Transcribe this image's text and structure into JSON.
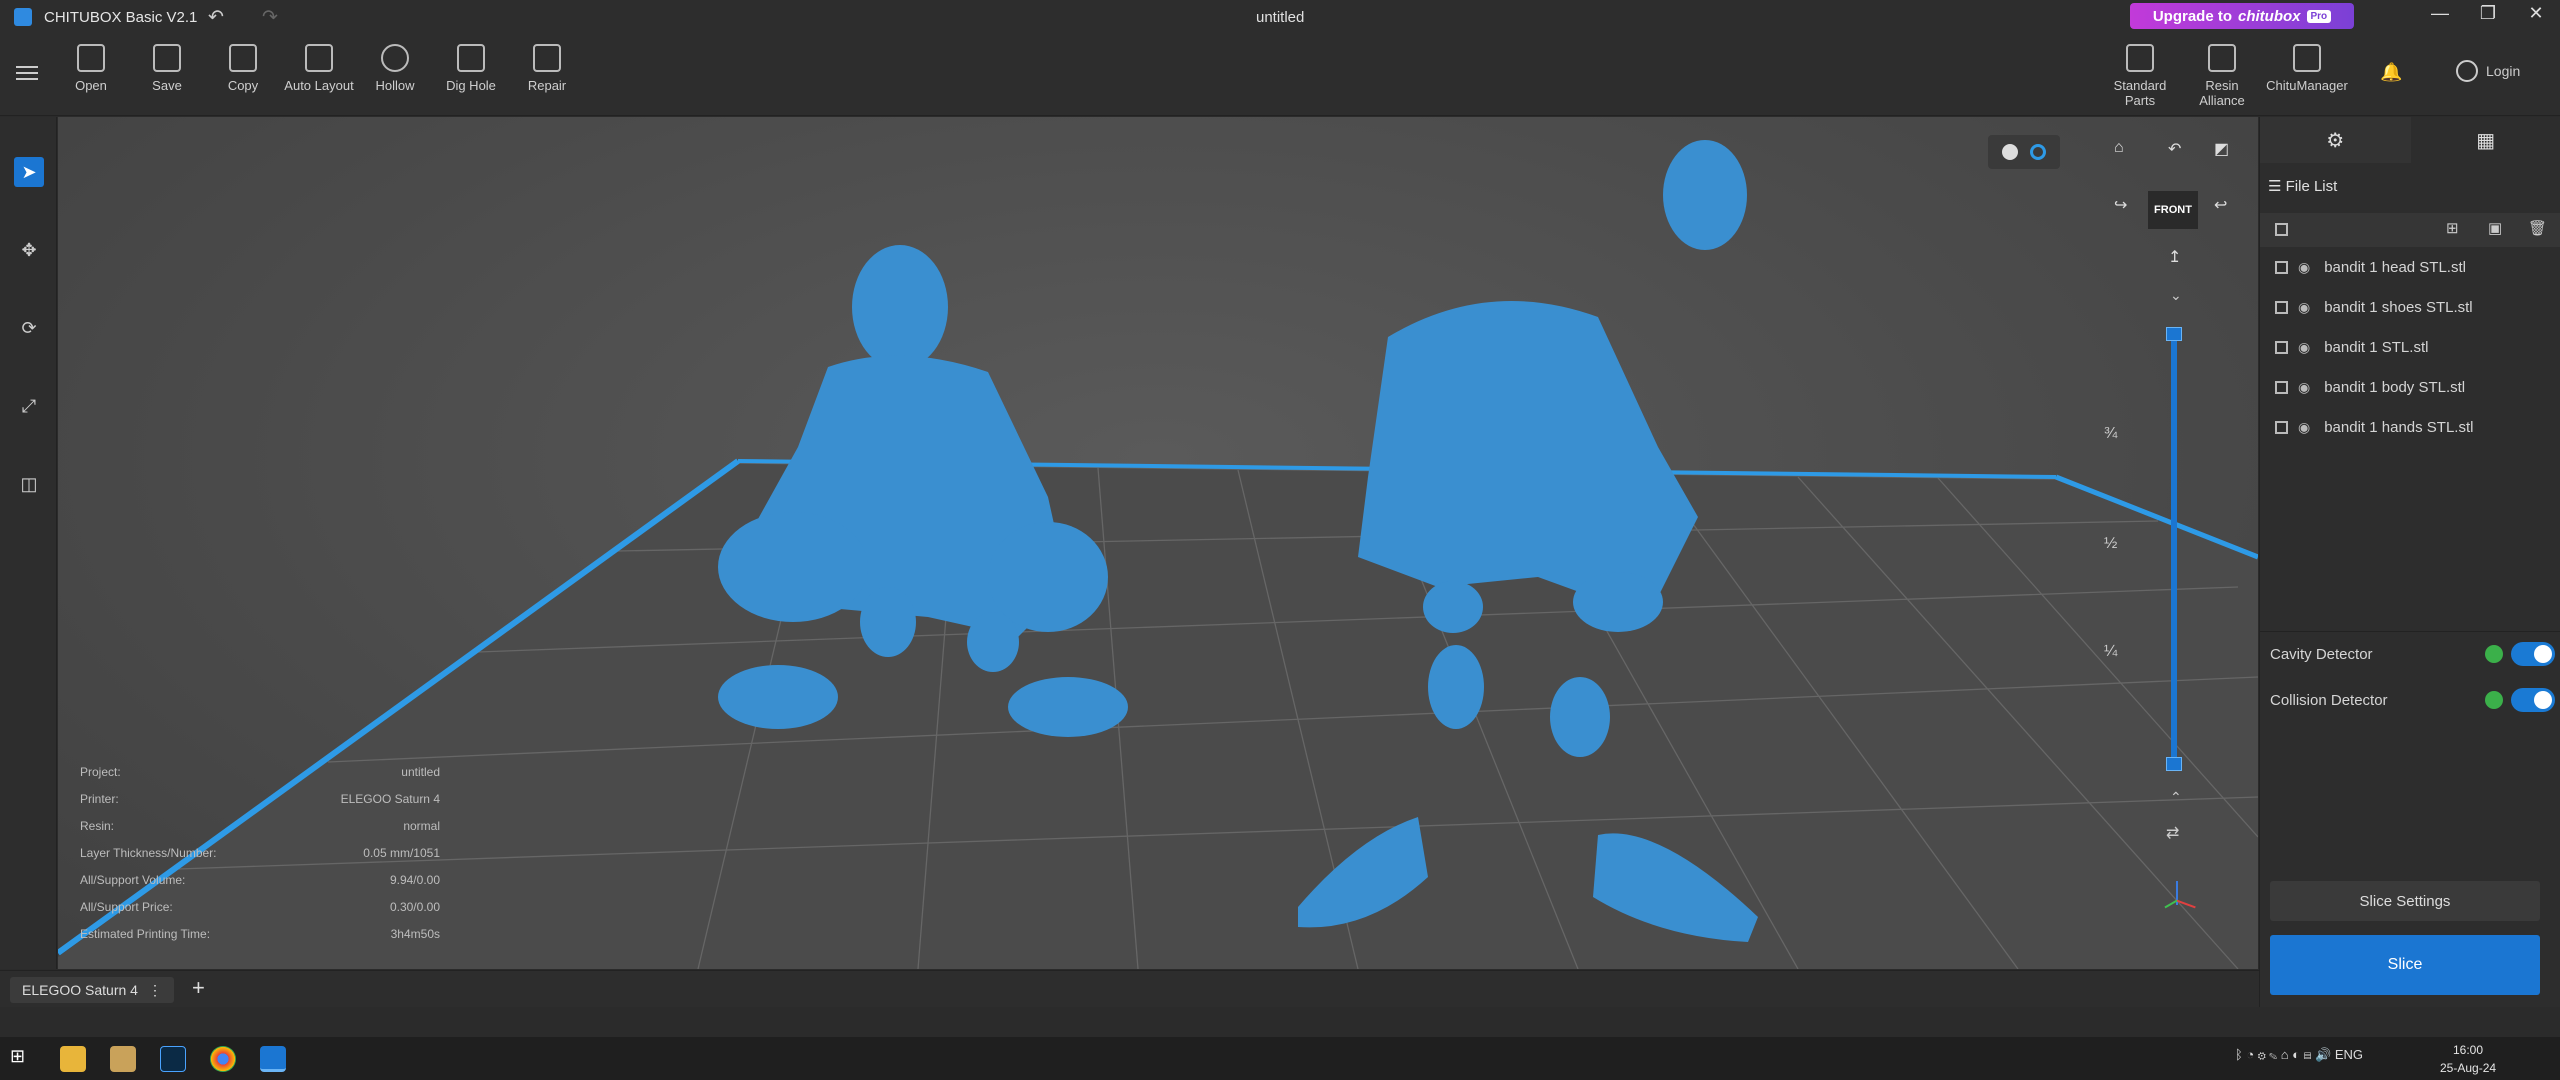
{
  "titlebar": {
    "app_title": "CHITUBOX Basic V2.1",
    "doc_title": "untitled",
    "upgrade_label": "Upgrade to",
    "upgrade_brand": "chitubox",
    "upgrade_badge": "Pro",
    "minimize": "—",
    "maximize": "❐",
    "close": "✕"
  },
  "toolbar": {
    "tools": [
      {
        "label": "Open"
      },
      {
        "label": "Save"
      },
      {
        "label": "Copy"
      },
      {
        "label": "Auto Layout"
      },
      {
        "label": "Hollow"
      },
      {
        "label": "Dig Hole"
      },
      {
        "label": "Repair"
      }
    ],
    "right_tools": [
      {
        "label": "Standard Parts"
      },
      {
        "label": "Resin Alliance"
      },
      {
        "label": "ChituManager"
      }
    ],
    "login_label": "Login"
  },
  "view": {
    "front_label": "FRONT",
    "slider_marks": [
      "¾",
      "½",
      "¼"
    ]
  },
  "info": [
    {
      "label": "Project:",
      "value": "untitled"
    },
    {
      "label": "Printer:",
      "value": "ELEGOO Saturn 4"
    },
    {
      "label": "Resin:",
      "value": "normal"
    },
    {
      "label": "Layer Thickness/Number:",
      "value": "0.05 mm/1051"
    },
    {
      "label": "All/Support Volume:",
      "value": "9.94/0.00"
    },
    {
      "label": "All/Support Price:",
      "value": "0.30/0.00"
    },
    {
      "label": "Estimated Printing Time:",
      "value": "3h4m50s"
    }
  ],
  "right_panel": {
    "file_list_title": "File List",
    "files": [
      {
        "name": "bandit 1 head STL.stl"
      },
      {
        "name": "bandit 1 shoes STL.stl"
      },
      {
        "name": "bandit 1 STL.stl"
      },
      {
        "name": "bandit 1 body STL.stl"
      },
      {
        "name": "bandit 1 hands STL.stl"
      }
    ],
    "cavity_detector": "Cavity Detector",
    "collision_detector": "Collision Detector",
    "slice_settings": "Slice Settings",
    "slice": "Slice"
  },
  "bottom": {
    "printer_tab": "ELEGOO Saturn 4",
    "add_tab": "+"
  },
  "taskbar": {
    "lang": "ENG",
    "time": "16:00",
    "date": "25-Aug-24"
  },
  "colors": {
    "accent": "#1b76d2",
    "model": "#3a8fd0",
    "upgrade_start": "#c23ad9",
    "upgrade_end": "#7b40d6"
  }
}
